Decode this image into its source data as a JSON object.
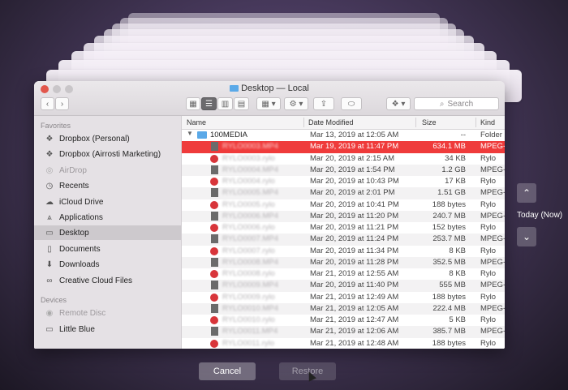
{
  "window": {
    "title": "Desktop — Local"
  },
  "toolbar": {
    "search_placeholder": "Search"
  },
  "sidebar": {
    "favorites_header": "Favorites",
    "favorites": [
      {
        "label": "Dropbox (Personal)",
        "icon": "dropbox-icon"
      },
      {
        "label": "Dropbox (Airrosti Marketing)",
        "icon": "dropbox-icon"
      },
      {
        "label": "AirDrop",
        "icon": "airdrop-icon"
      },
      {
        "label": "Recents",
        "icon": "clock-icon"
      },
      {
        "label": "iCloud Drive",
        "icon": "cloud-icon"
      },
      {
        "label": "Applications",
        "icon": "applications-icon"
      },
      {
        "label": "Desktop",
        "icon": "desktop-icon"
      },
      {
        "label": "Documents",
        "icon": "documents-icon"
      },
      {
        "label": "Downloads",
        "icon": "downloads-icon"
      },
      {
        "label": "Creative Cloud Files",
        "icon": "creative-cloud-icon"
      }
    ],
    "devices_header": "Devices",
    "devices": [
      {
        "label": "Remote Disc",
        "icon": "disc-icon"
      },
      {
        "label": "Little Blue",
        "icon": "drive-icon"
      }
    ]
  },
  "columns": {
    "name": "Name",
    "date": "Date Modified",
    "size": "Size",
    "kind": "Kind"
  },
  "rows": [
    {
      "name": "100MEDIA",
      "date": "Mar 13, 2019 at 12:05 AM",
      "size": "--",
      "kind": "Folder",
      "type": "folder"
    },
    {
      "name": "RYLO0003.MP4",
      "date": "Mar 19, 2019 at 11:47 PM",
      "size": "634.1 MB",
      "kind": "MPEG-4",
      "type": "doc"
    },
    {
      "name": "RYLO0003.rylo",
      "date": "Mar 20, 2019 at 2:15 AM",
      "size": "34 KB",
      "kind": "Rylo",
      "type": "rylo"
    },
    {
      "name": "RYLO0004.MP4",
      "date": "Mar 20, 2019 at 1:54 PM",
      "size": "1.2 GB",
      "kind": "MPEG-4",
      "type": "doc"
    },
    {
      "name": "RYLO0004.rylo",
      "date": "Mar 20, 2019 at 10:43 PM",
      "size": "17 KB",
      "kind": "Rylo",
      "type": "rylo"
    },
    {
      "name": "RYLO0005.MP4",
      "date": "Mar 20, 2019 at 2:01 PM",
      "size": "1.51 GB",
      "kind": "MPEG-4",
      "type": "doc"
    },
    {
      "name": "RYLO0005.rylo",
      "date": "Mar 20, 2019 at 10:41 PM",
      "size": "188 bytes",
      "kind": "Rylo",
      "type": "rylo"
    },
    {
      "name": "RYLO0006.MP4",
      "date": "Mar 20, 2019 at 11:20 PM",
      "size": "240.7 MB",
      "kind": "MPEG-4",
      "type": "doc"
    },
    {
      "name": "RYLO0006.rylo",
      "date": "Mar 20, 2019 at 11:21 PM",
      "size": "152 bytes",
      "kind": "Rylo",
      "type": "rylo"
    },
    {
      "name": "RYLO0007.MP4",
      "date": "Mar 20, 2019 at 11:24 PM",
      "size": "253.7 MB",
      "kind": "MPEG-4",
      "type": "doc"
    },
    {
      "name": "RYLO0007.rylo",
      "date": "Mar 20, 2019 at 11:34 PM",
      "size": "8 KB",
      "kind": "Rylo",
      "type": "rylo"
    },
    {
      "name": "RYLO0008.MP4",
      "date": "Mar 20, 2019 at 11:28 PM",
      "size": "352.5 MB",
      "kind": "MPEG-4",
      "type": "doc"
    },
    {
      "name": "RYLO0008.rylo",
      "date": "Mar 21, 2019 at 12:55 AM",
      "size": "8 KB",
      "kind": "Rylo",
      "type": "rylo"
    },
    {
      "name": "RYLO0009.MP4",
      "date": "Mar 20, 2019 at 11:40 PM",
      "size": "555 MB",
      "kind": "MPEG-4",
      "type": "doc"
    },
    {
      "name": "RYLO0009.rylo",
      "date": "Mar 21, 2019 at 12:49 AM",
      "size": "188 bytes",
      "kind": "Rylo",
      "type": "rylo"
    },
    {
      "name": "RYLO0010.MP4",
      "date": "Mar 21, 2019 at 12:05 AM",
      "size": "222.4 MB",
      "kind": "MPEG-4",
      "type": "doc"
    },
    {
      "name": "RYLO0010.rylo",
      "date": "Mar 21, 2019 at 12:47 AM",
      "size": "5 KB",
      "kind": "Rylo",
      "type": "rylo"
    },
    {
      "name": "RYLO0011.MP4",
      "date": "Mar 21, 2019 at 12:06 AM",
      "size": "385.7 MB",
      "kind": "MPEG-4",
      "type": "doc"
    },
    {
      "name": "RYLO0011.rylo",
      "date": "Mar 21, 2019 at 12:48 AM",
      "size": "188 bytes",
      "kind": "Rylo",
      "type": "rylo"
    }
  ],
  "selected_row": 1,
  "timeline": {
    "label": "Today (Now)"
  },
  "actions": {
    "cancel": "Cancel",
    "restore": "Restore"
  },
  "colors": {
    "selection": "#ef3b3b",
    "folder": "#5aa9e8",
    "rylo": "#d8353a"
  }
}
